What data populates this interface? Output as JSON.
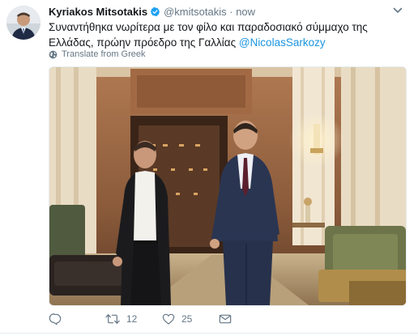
{
  "tweet": {
    "author_name": "Kyriakos Mitsotakis",
    "handle": "@kmitsotakis",
    "separator": "·",
    "time": "now",
    "text_line1": "Συναντήθηκα νωρίτερα με τον φίλο και παραδοσιακό σύμμαχο της",
    "text_line2": "Ελλάδας, πρώην πρόεδρο της Γαλλίας ",
    "mention": "@NicolasSarkozy",
    "translate_label": "Translate from Greek"
  },
  "actions": {
    "reply_count": "",
    "retweet_count": "12",
    "like_count": "25"
  },
  "colors": {
    "text": "#14171a",
    "secondary": "#657786",
    "link": "#1b95e0",
    "verified": "#1da1f2"
  },
  "icons": [
    "avatar",
    "verified-badge-icon",
    "chevron-down-icon",
    "globe-icon",
    "reply-icon",
    "retweet-icon",
    "like-icon",
    "direct-message-icon"
  ]
}
